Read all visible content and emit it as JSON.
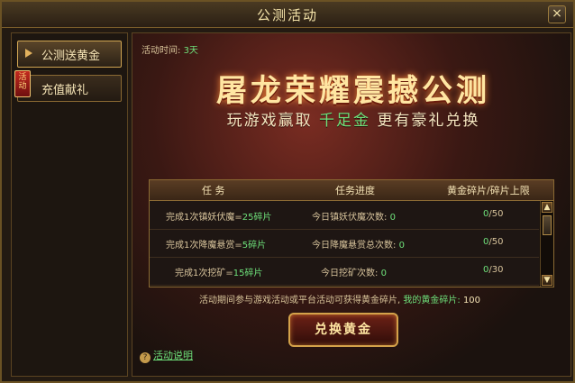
{
  "window": {
    "title": "公测活动",
    "close_label": "×"
  },
  "sidebar": {
    "items": [
      {
        "label": "公测送黄金",
        "active": true
      },
      {
        "label": "充值献礼",
        "active": false,
        "badge": "活动"
      }
    ]
  },
  "main": {
    "activity_time_label": "活动时间:",
    "activity_time_value": "3天",
    "hero_title": "屠龙荣耀震撼公测",
    "hero_subtitle_before": "玩游戏赢取",
    "hero_subtitle_highlight": "千足金",
    "hero_subtitle_after": "更有豪礼兑换",
    "table": {
      "headers": [
        "任  务",
        "任务进度",
        "黄金碎片/碎片上限"
      ],
      "rows": [
        {
          "task_prefix": "完成1次镇妖伏魔=",
          "reward": "25碎片",
          "progress_label": "今日镇妖伏魔次数:",
          "progress_value": "0",
          "count": "0",
          "limit": "/50"
        },
        {
          "task_prefix": "完成1次降魔悬赏=",
          "reward": "5碎片",
          "progress_label": "今日降魔悬赏总次数:",
          "progress_value": "0",
          "count": "0",
          "limit": "/50"
        },
        {
          "task_prefix": "完成1次挖矿=",
          "reward": "15碎片",
          "progress_label": "今日挖矿次数:",
          "progress_value": "0",
          "count": "0",
          "limit": "/30"
        }
      ]
    },
    "footer_note_prefix": "活动期间参与游戏活动或平台活动可获得黄金碎片,",
    "footer_note_highlight": "我的黄金碎片:",
    "footer_note_value": "100",
    "exchange_button_label": "兑换黄金",
    "help_link_label": "活动说明"
  },
  "icons": {
    "scroll_up": "▲",
    "scroll_down": "▼",
    "help": "?"
  },
  "colors": {
    "accent_green": "#6ee07a",
    "gold": "#f4e3b5"
  }
}
